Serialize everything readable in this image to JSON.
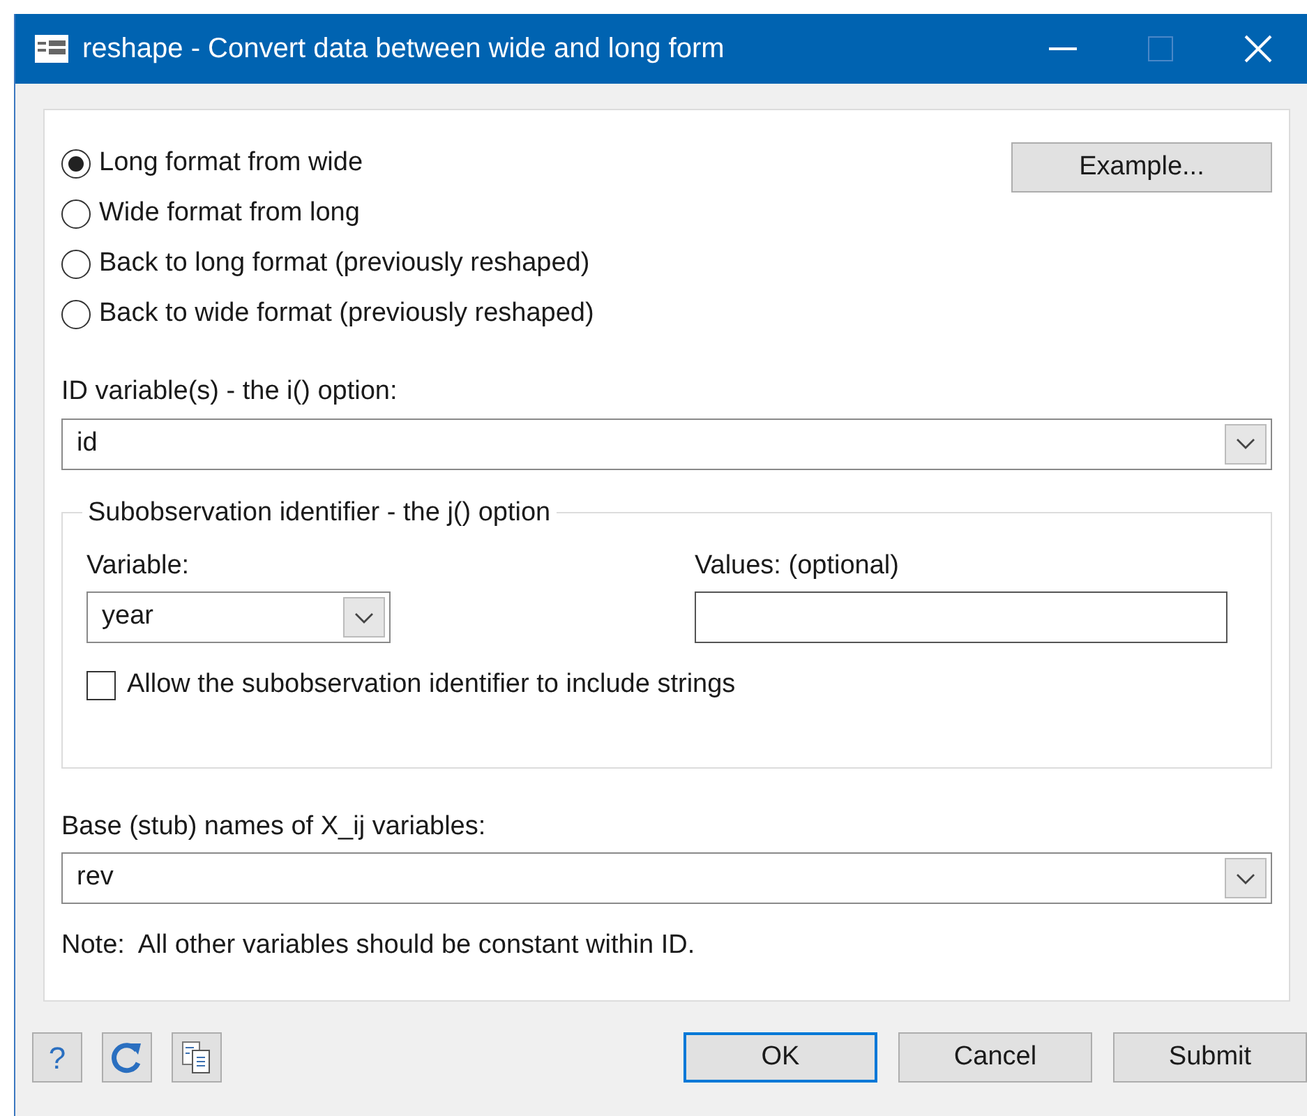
{
  "window": {
    "title": "reshape - Convert data between wide and long form"
  },
  "modes": [
    {
      "label": "Long format from wide",
      "selected": true
    },
    {
      "label": "Wide format from long",
      "selected": false
    },
    {
      "label": "Back to long format (previously reshaped)",
      "selected": false
    },
    {
      "label": "Back to wide format (previously reshaped)",
      "selected": false
    }
  ],
  "example_button": "Example...",
  "id_field": {
    "label": "ID variable(s) - the i() option:",
    "value": "id"
  },
  "j_group": {
    "legend": "Subobservation identifier - the j() option",
    "variable": {
      "label": "Variable:",
      "value": "year"
    },
    "values": {
      "label": "Values: (optional)"
    },
    "allow_strings": {
      "label": "Allow the subobservation identifier to include strings",
      "checked": false
    }
  },
  "stub_field": {
    "label": "Base (stub) names of X_ij variables:",
    "value": "rev"
  },
  "note": "Note:  All other variables should be constant within ID.",
  "help_button": "?",
  "buttons": [
    {
      "label": "OK",
      "selected": true
    },
    {
      "label": "Cancel",
      "selected": false
    },
    {
      "label": "Submit",
      "selected": false
    }
  ]
}
